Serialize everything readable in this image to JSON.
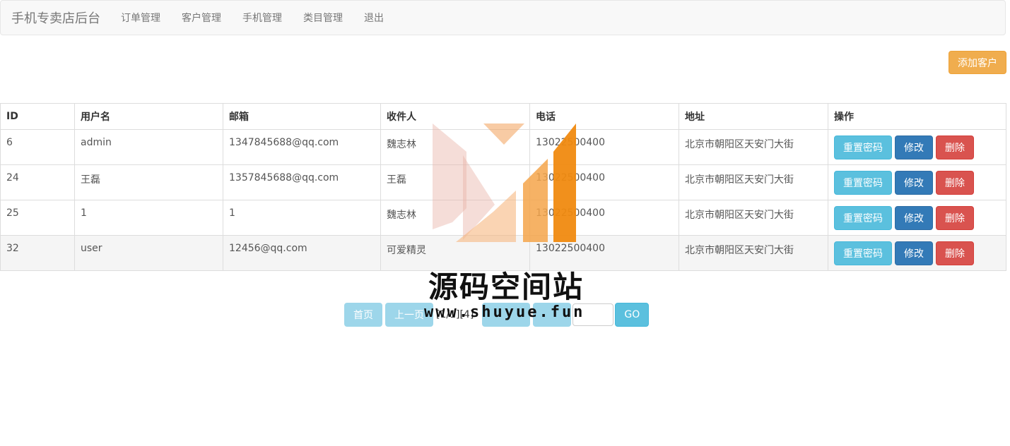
{
  "navbar": {
    "brand": "手机专卖店后台",
    "items": [
      "订单管理",
      "客户管理",
      "手机管理",
      "类目管理",
      "退出"
    ]
  },
  "actions": {
    "add_customer": "添加客户"
  },
  "table": {
    "headers": [
      "ID",
      "用户名",
      "邮箱",
      "收件人",
      "电话",
      "地址",
      "操作"
    ],
    "rows": [
      {
        "id": "6",
        "username": "admin",
        "email": "1347845688@qq.com",
        "recipient": "魏志林",
        "phone": "13022500400",
        "address": "北京市朝阳区天安门大街"
      },
      {
        "id": "24",
        "username": "王磊",
        "email": "1357845688@qq.com",
        "recipient": "王磊",
        "phone": "13022500400",
        "address": "北京市朝阳区天安门大街"
      },
      {
        "id": "25",
        "username": "1",
        "email": "1",
        "recipient": "魏志林",
        "phone": "13022500400",
        "address": "北京市朝阳区天安门大街"
      },
      {
        "id": "32",
        "username": "user",
        "email": "12456@qq.com",
        "recipient": "可爱精灵",
        "phone": "13022500400",
        "address": "北京市朝阳区天安门大街"
      }
    ],
    "row_actions": {
      "reset": "重置密码",
      "edit": "修改",
      "delete": "删除"
    }
  },
  "pagination": {
    "first": "首页",
    "prev": "上一页",
    "info": "[1/1][4]",
    "go": "GO"
  },
  "watermark": {
    "title": "源码空间站",
    "url": "www.shuyue.fun"
  },
  "colors": {
    "warning": "#f0ad4e",
    "info": "#5bc0de",
    "primary": "#337ab7",
    "danger": "#d9534f"
  }
}
